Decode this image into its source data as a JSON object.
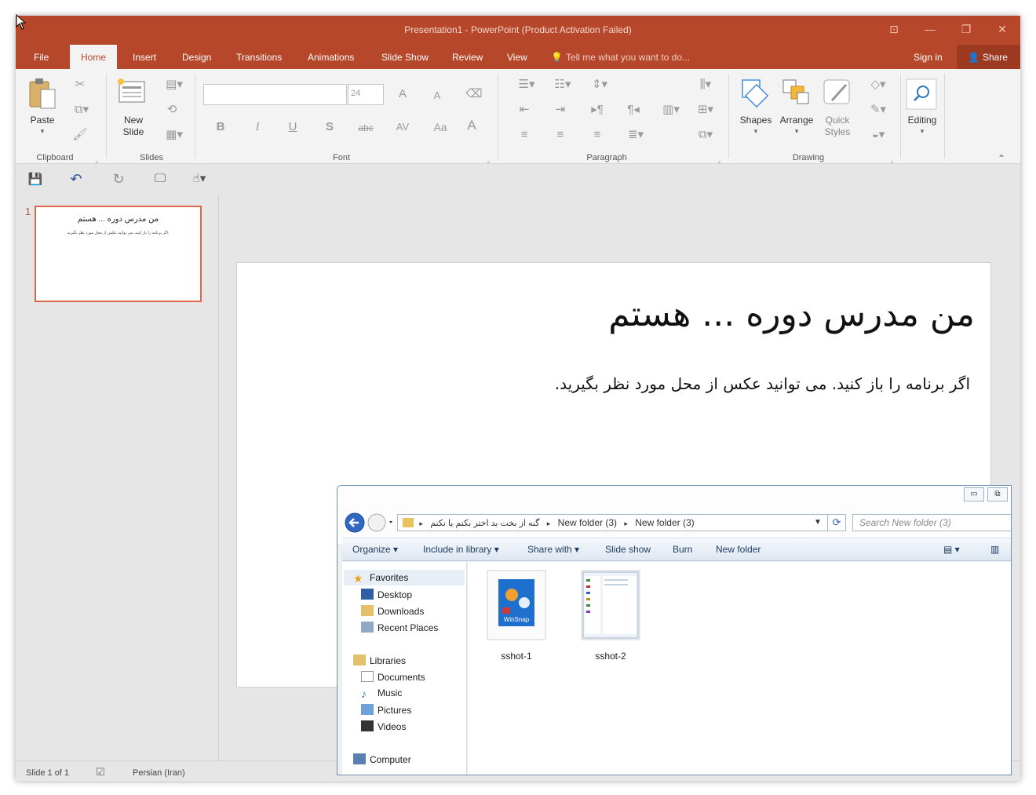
{
  "window": {
    "title": "Presentation1 - PowerPoint (Product Activation Failed)",
    "controls": {
      "ribbon_display": "⊡",
      "minimize": "—",
      "restore": "❐",
      "close": "✕"
    }
  },
  "tabs": [
    {
      "label": "File"
    },
    {
      "label": "Home"
    },
    {
      "label": "Insert"
    },
    {
      "label": "Design"
    },
    {
      "label": "Transitions"
    },
    {
      "label": "Animations"
    },
    {
      "label": "Slide Show"
    },
    {
      "label": "Review"
    },
    {
      "label": "View"
    }
  ],
  "tell_me": "Tell me what you want to do...",
  "sign_in": "Sign in",
  "share": "Share",
  "ribbon": {
    "clipboard": {
      "label": "Clipboard",
      "paste": "Paste"
    },
    "slides": {
      "label": "Slides",
      "new_slide_1": "New",
      "new_slide_2": "Slide"
    },
    "font": {
      "label": "Font",
      "size": "24",
      "bold": "B",
      "italic": "I",
      "underline": "U",
      "shadow": "S",
      "strike": "abc",
      "spacing": "AV",
      "case": "Aa",
      "grow": "A",
      "shrink": "A",
      "color": "A"
    },
    "paragraph": {
      "label": "Paragraph"
    },
    "drawing": {
      "label": "Drawing",
      "shapes": "Shapes",
      "arrange": "Arrange",
      "quick_1": "Quick",
      "quick_2": "Styles"
    },
    "editing": {
      "label": "Editing"
    }
  },
  "slide": {
    "number": "1",
    "title": "من مدرس دوره ... هستم",
    "subtitle": "اگر برنامه را باز کنید. می توانید عکس از محل مورد نظر بگیرید."
  },
  "status": {
    "slide": "Slide 1 of 1",
    "language": "Persian (Iran)"
  },
  "explorer": {
    "address": {
      "root": "گنه از بخت بد اختر بکنم یا نکنم",
      "seg1": "New folder (3)",
      "seg2": "New folder (3)"
    },
    "search_placeholder": "Search New folder (3)",
    "commands": {
      "organize": "Organize",
      "include": "Include in library",
      "share": "Share with",
      "slideshow": "Slide show",
      "burn": "Burn",
      "newfolder": "New folder"
    },
    "nav": {
      "favorites": "Favorites",
      "desktop": "Desktop",
      "downloads": "Downloads",
      "recent": "Recent Places",
      "libraries": "Libraries",
      "documents": "Documents",
      "music": "Music",
      "pictures": "Pictures",
      "videos": "Videos",
      "computer": "Computer"
    },
    "files": [
      {
        "name": "sshot-1",
        "thumb_label": "WinSnap"
      },
      {
        "name": "sshot-2"
      }
    ]
  },
  "colors": {
    "accent": "#b7472a",
    "selection": "#e0664a"
  }
}
